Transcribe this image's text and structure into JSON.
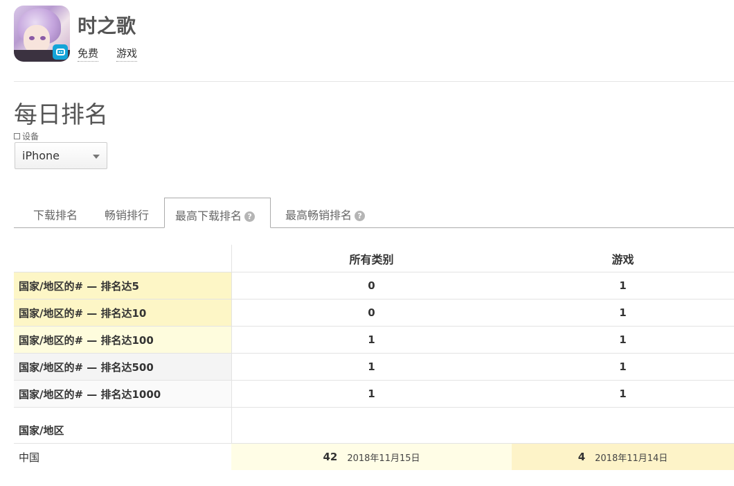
{
  "app": {
    "title": "时之歌",
    "tags": [
      "免费",
      "游戏"
    ],
    "icon": "app-icon-anime-character"
  },
  "section": {
    "title": "每日排名",
    "device_label": "设备",
    "device_value": "iPhone"
  },
  "tabs": [
    {
      "label": "下载排名",
      "active": false,
      "help": false
    },
    {
      "label": "畅销排行",
      "active": false,
      "help": false
    },
    {
      "label": "最高下载排名",
      "active": true,
      "help": true
    },
    {
      "label": "最高畅销排名",
      "active": false,
      "help": true
    }
  ],
  "table": {
    "columns": [
      "所有类别",
      "游戏"
    ],
    "rows": [
      {
        "label": "国家/地区的# — 排名达5",
        "values": [
          "0",
          "1"
        ],
        "highlight": "#fdf6c6"
      },
      {
        "label": "国家/地区的# — 排名达10",
        "values": [
          "0",
          "1"
        ],
        "highlight": "#fdf6c6"
      },
      {
        "label": "国家/地区的# — 排名达100",
        "values": [
          "1",
          "1"
        ],
        "highlight": "#fefcdd"
      },
      {
        "label": "国家/地区的# — 排名达500",
        "values": [
          "1",
          "1"
        ],
        "highlight": "#f4f4f4"
      },
      {
        "label": "国家/地区的# — 排名达1000",
        "values": [
          "1",
          "1"
        ],
        "highlight": "#fafafa"
      }
    ],
    "country_header": "国家/地区",
    "country_rows": [
      {
        "country": "中国",
        "all_rank": "42",
        "all_date": "2018年11月15日",
        "game_rank": "4",
        "game_date": "2018年11月14日"
      }
    ]
  },
  "colors": {
    "highlight_strong": "#fdf6c6",
    "highlight_light": "#fefcdd",
    "cell_all": "#fffde6",
    "cell_game": "#fdf3c8",
    "border": "#e3e3e3"
  }
}
